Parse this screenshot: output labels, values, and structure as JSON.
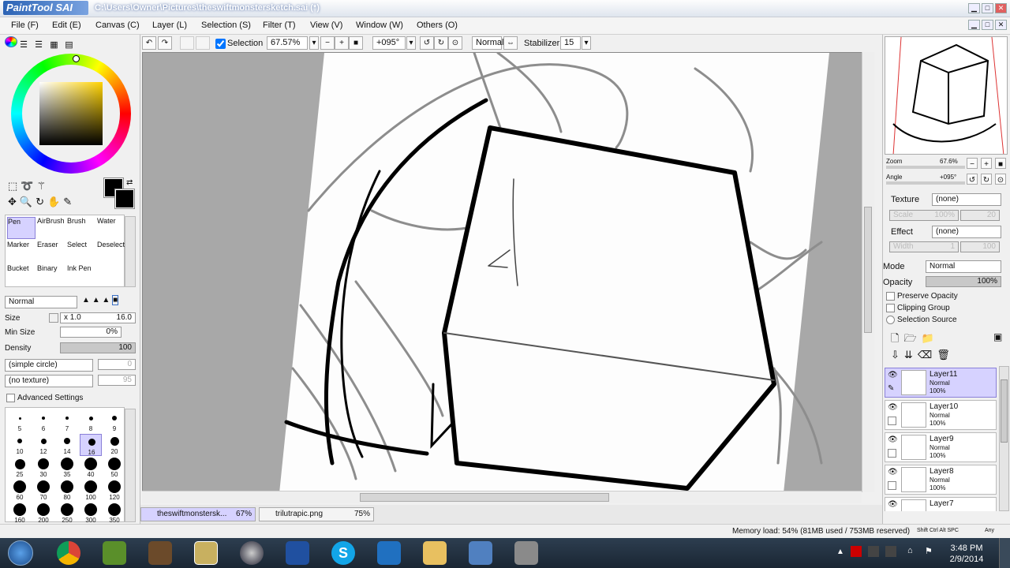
{
  "title": {
    "logo": "PaintTool SAI",
    "text": "C:\\Users\\Owner\\Pictures\\theswiftmonstersketch.sai (*)"
  },
  "menus": [
    "File (F)",
    "Edit (E)",
    "Canvas (C)",
    "Layer (L)",
    "Selection (S)",
    "Filter (T)",
    "View (V)",
    "Window (W)",
    "Others (O)"
  ],
  "toolbar": {
    "selection_label": "Selection",
    "zoom": "67.57%",
    "angle": "+095°",
    "mode": "Normal",
    "stabilizer_label": "Stabilizer",
    "stabilizer": "15"
  },
  "tools": [
    {
      "label": "Pen"
    },
    {
      "label": "AirBrush"
    },
    {
      "label": "Brush"
    },
    {
      "label": "Water"
    },
    {
      "label": "Marker"
    },
    {
      "label": "Eraser"
    },
    {
      "label": "Select"
    },
    {
      "label": "Deselect"
    },
    {
      "label": "Bucket"
    },
    {
      "label": "Binary"
    },
    {
      "label": "Ink Pen"
    }
  ],
  "brush": {
    "blend_mode": "Normal",
    "size_label": "Size",
    "size_mult": "x 1.0",
    "size": "16.0",
    "min_size_label": "Min Size",
    "min_size": "0%",
    "density_label": "Density",
    "density": "100",
    "shape": "(simple circle)",
    "shape_val": "0",
    "texture": "(no texture)",
    "texture_val": "95",
    "advanced": "Advanced Settings"
  },
  "brush_sizes": [
    "5",
    "6",
    "7",
    "8",
    "9",
    "10",
    "12",
    "14",
    "16",
    "20",
    "25",
    "30",
    "35",
    "40",
    "50",
    "60",
    "70",
    "80",
    "100",
    "120",
    "160",
    "200",
    "250",
    "300",
    "350"
  ],
  "navigator": {
    "zoom_label": "Zoom",
    "zoom": "67.6%",
    "angle_label": "Angle",
    "angle": "+095°"
  },
  "layer_props": {
    "texture_label": "Texture",
    "texture": "(none)",
    "scale_label": "Scale",
    "scale_val": "100%",
    "scale_num": "20",
    "effect_label": "Effect",
    "effect": "(none)",
    "width_label": "Width",
    "width_val": "1",
    "width_num": "100",
    "mode_label": "Mode",
    "mode": "Normal",
    "opacity_label": "Opacity",
    "opacity": "100%",
    "preserve": "Preserve Opacity",
    "clipping": "Clipping Group",
    "selsource": "Selection Source"
  },
  "layers": [
    {
      "name": "Layer11",
      "mode": "Normal",
      "opacity": "100%"
    },
    {
      "name": "Layer10",
      "mode": "Normal",
      "opacity": "100%"
    },
    {
      "name": "Layer9",
      "mode": "Normal",
      "opacity": "100%"
    },
    {
      "name": "Layer8",
      "mode": "Normal",
      "opacity": "100%"
    },
    {
      "name": "Layer7",
      "mode": "",
      "opacity": ""
    }
  ],
  "tabs": [
    {
      "name": "theswiftmonstersk...",
      "zoom": "67%"
    },
    {
      "name": "trilutrapic.png",
      "zoom": "75%"
    }
  ],
  "status": {
    "memory": "Memory load: 54% (81MB used / 753MB reserved)",
    "keys": "Shift Ctrl Alt SPC",
    "any": "Any"
  },
  "clock": {
    "time": "3:48 PM",
    "date": "2/9/2014"
  },
  "colors": {
    "primary": "#000000",
    "accent": "#3a6fc4",
    "selected_layer": "#d6d2ff"
  }
}
